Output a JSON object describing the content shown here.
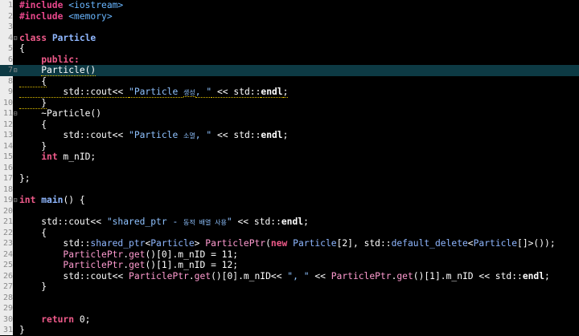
{
  "editor": {
    "lines": [
      {
        "n": "1",
        "fold": "",
        "tokens": [
          {
            "t": "#include",
            "c": "pp"
          },
          {
            "t": " <iostream>",
            "c": "inc"
          }
        ]
      },
      {
        "n": "2",
        "fold": "",
        "tokens": [
          {
            "t": "#include",
            "c": "pp"
          },
          {
            "t": " <memory>",
            "c": "inc"
          }
        ]
      },
      {
        "n": "3",
        "fold": "",
        "tokens": []
      },
      {
        "n": "4",
        "fold": "⊟",
        "tokens": [
          {
            "t": "class",
            "c": "kw"
          },
          {
            "t": " Particle",
            "c": "cls"
          }
        ]
      },
      {
        "n": "5",
        "fold": "",
        "tokens": [
          {
            "t": "{",
            "c": ""
          }
        ]
      },
      {
        "n": "6",
        "fold": "",
        "tokens": [
          {
            "t": "    public:",
            "c": "kw"
          }
        ]
      },
      {
        "n": "7",
        "fold": "⊟",
        "current": true,
        "tokens": [
          {
            "t": "    ",
            "c": ""
          },
          {
            "t": "Particle()",
            "c": "fn",
            "squig": true
          }
        ]
      },
      {
        "n": "8",
        "fold": "",
        "tokens": [
          {
            "t": "    {",
            "c": "",
            "squig": true
          }
        ]
      },
      {
        "n": "9",
        "fold": "",
        "tokens": [
          {
            "t": "        std::cout<< ",
            "c": "",
            "squig": true
          },
          {
            "t": "\"Particle ",
            "c": "str",
            "squig": true
          },
          {
            "t": "생성",
            "c": "str sm",
            "squig": true
          },
          {
            "t": ", \"",
            "c": "str",
            "squig": true
          },
          {
            "t": " << std::",
            "c": "",
            "squig": true
          },
          {
            "t": "endl",
            "c": "endl",
            "squig": true
          },
          {
            "t": ";",
            "c": "",
            "squig": true
          }
        ]
      },
      {
        "n": "10",
        "fold": "",
        "tokens": [
          {
            "t": "    }",
            "c": "",
            "squig": true
          }
        ]
      },
      {
        "n": "11",
        "fold": "⊟",
        "tokens": [
          {
            "t": "    ~Particle()",
            "c": ""
          }
        ]
      },
      {
        "n": "12",
        "fold": "",
        "tokens": [
          {
            "t": "    {",
            "c": ""
          }
        ]
      },
      {
        "n": "13",
        "fold": "",
        "tokens": [
          {
            "t": "        std::cout<< ",
            "c": ""
          },
          {
            "t": "\"Particle ",
            "c": "str"
          },
          {
            "t": "소멸",
            "c": "str sm"
          },
          {
            "t": ", \"",
            "c": "str"
          },
          {
            "t": " << std::",
            "c": ""
          },
          {
            "t": "endl",
            "c": "endl"
          },
          {
            "t": ";",
            "c": ""
          }
        ]
      },
      {
        "n": "14",
        "fold": "",
        "tokens": [
          {
            "t": "    }",
            "c": ""
          }
        ]
      },
      {
        "n": "15",
        "fold": "",
        "tokens": [
          {
            "t": "    ",
            "c": ""
          },
          {
            "t": "int",
            "c": "kw"
          },
          {
            "t": " m_nID;",
            "c": ""
          }
        ]
      },
      {
        "n": "16",
        "fold": "",
        "tokens": []
      },
      {
        "n": "17",
        "fold": "",
        "tokens": [
          {
            "t": "};",
            "c": ""
          }
        ]
      },
      {
        "n": "18",
        "fold": "",
        "tokens": []
      },
      {
        "n": "19",
        "fold": "⊟",
        "tokens": [
          {
            "t": "int",
            "c": "kw"
          },
          {
            "t": " ",
            "c": ""
          },
          {
            "t": "main",
            "c": "cls"
          },
          {
            "t": "() {",
            "c": ""
          }
        ]
      },
      {
        "n": "20",
        "fold": "",
        "tokens": []
      },
      {
        "n": "21",
        "fold": "",
        "tokens": [
          {
            "t": "    std::cout<< ",
            "c": ""
          },
          {
            "t": "\"shared_ptr - ",
            "c": "str"
          },
          {
            "t": "동적 배열 사용",
            "c": "str sm"
          },
          {
            "t": "\"",
            "c": "str"
          },
          {
            "t": " << std::",
            "c": ""
          },
          {
            "t": "endl",
            "c": "endl"
          },
          {
            "t": ";",
            "c": ""
          }
        ]
      },
      {
        "n": "22",
        "fold": "",
        "tokens": [
          {
            "t": "    {",
            "c": ""
          }
        ]
      },
      {
        "n": "23",
        "fold": "",
        "tokens": [
          {
            "t": "        std::",
            "c": ""
          },
          {
            "t": "shared_ptr",
            "c": "type"
          },
          {
            "t": "<",
            "c": ""
          },
          {
            "t": "Particle",
            "c": "type"
          },
          {
            "t": "> ",
            "c": ""
          },
          {
            "t": "ParticlePtr",
            "c": "var"
          },
          {
            "t": "(",
            "c": ""
          },
          {
            "t": "new",
            "c": "kw"
          },
          {
            "t": " ",
            "c": ""
          },
          {
            "t": "Particle",
            "c": "type"
          },
          {
            "t": "[2], std::",
            "c": ""
          },
          {
            "t": "default_delete",
            "c": "type"
          },
          {
            "t": "<",
            "c": ""
          },
          {
            "t": "Particle",
            "c": "type"
          },
          {
            "t": "[]>());",
            "c": ""
          }
        ]
      },
      {
        "n": "24",
        "fold": "",
        "tokens": [
          {
            "t": "        ",
            "c": ""
          },
          {
            "t": "ParticlePtr",
            "c": "var"
          },
          {
            "t": ".",
            "c": ""
          },
          {
            "t": "get",
            "c": "var"
          },
          {
            "t": "()[0].m_nID = 11;",
            "c": ""
          }
        ]
      },
      {
        "n": "25",
        "fold": "",
        "tokens": [
          {
            "t": "        ",
            "c": ""
          },
          {
            "t": "ParticlePtr",
            "c": "var"
          },
          {
            "t": ".",
            "c": ""
          },
          {
            "t": "get",
            "c": "var"
          },
          {
            "t": "()[1].m_nID = 12;",
            "c": ""
          }
        ]
      },
      {
        "n": "26",
        "fold": "",
        "tokens": [
          {
            "t": "        std::cout<< ",
            "c": ""
          },
          {
            "t": "ParticlePtr",
            "c": "var"
          },
          {
            "t": ".",
            "c": ""
          },
          {
            "t": "get",
            "c": "var"
          },
          {
            "t": "()[0].m_nID<< ",
            "c": ""
          },
          {
            "t": "\", \"",
            "c": "str"
          },
          {
            "t": " << ",
            "c": ""
          },
          {
            "t": "ParticlePtr",
            "c": "var"
          },
          {
            "t": ".",
            "c": ""
          },
          {
            "t": "get",
            "c": "var"
          },
          {
            "t": "()[1].m_nID << std::",
            "c": ""
          },
          {
            "t": "endl",
            "c": "endl"
          },
          {
            "t": ";",
            "c": ""
          }
        ]
      },
      {
        "n": "27",
        "fold": "",
        "tokens": [
          {
            "t": "    }",
            "c": ""
          }
        ]
      },
      {
        "n": "28",
        "fold": "",
        "tokens": []
      },
      {
        "n": "29",
        "fold": "",
        "tokens": []
      },
      {
        "n": "30",
        "fold": "",
        "tokens": [
          {
            "t": "    ",
            "c": ""
          },
          {
            "t": "return",
            "c": "kw"
          },
          {
            "t": " 0;",
            "c": ""
          }
        ]
      },
      {
        "n": "31",
        "fold": "",
        "tokens": [
          {
            "t": "}",
            "c": ""
          }
        ]
      }
    ]
  }
}
